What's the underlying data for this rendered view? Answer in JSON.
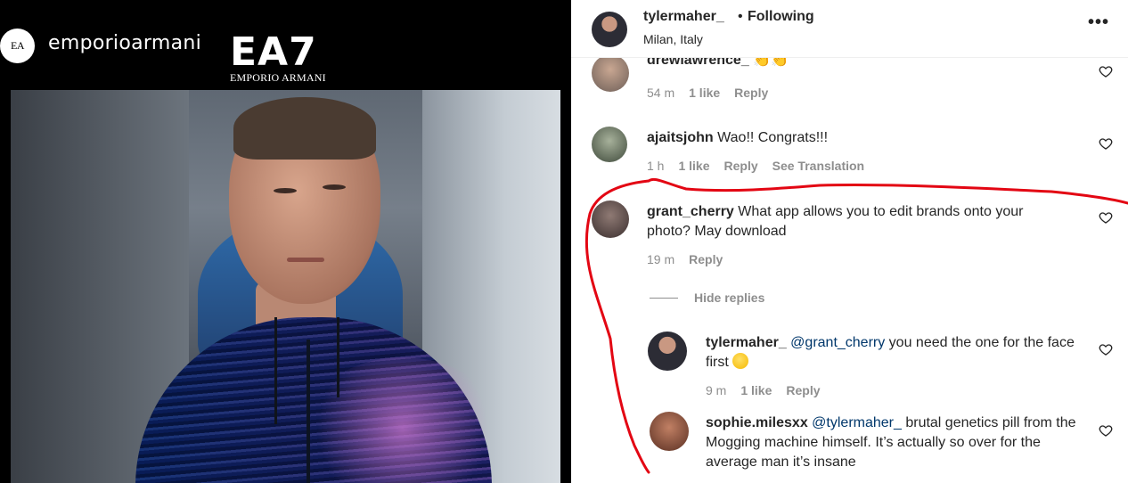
{
  "post": {
    "brand_logo_text": "EA",
    "brand_name": "emporioarmani",
    "ea7_big": "EA7",
    "ea7_small": "EMPORIO ARMANI"
  },
  "header": {
    "username": "tylermaher_",
    "dot": "•",
    "follow_label": "Following",
    "location": "Milan, Italy",
    "more_icon": "more-options-icon"
  },
  "comments": [
    {
      "username": "drewlawrence_",
      "text": " 👏👏",
      "time": "54 m",
      "likes": "1 like",
      "reply": "Reply"
    },
    {
      "username": "ajaitsjohn",
      "text": " Wao!! Congrats!!!",
      "time": "1 h",
      "likes": "1 like",
      "reply": "Reply",
      "translate": "See Translation"
    },
    {
      "username": "grant_cherry",
      "text": " What app allows you to edit brands onto your photo? May download",
      "time": "19 m",
      "reply": "Reply"
    }
  ],
  "hide_replies_label": "Hide replies",
  "replies": [
    {
      "username": "tylermaher_",
      "mention": "@grant_cherry",
      "text": " you need the one for the face first ",
      "time": "9 m",
      "likes": "1 like",
      "reply": "Reply"
    },
    {
      "username": "sophie.milesxx",
      "mention": "@tylermaher_",
      "text": " brutal genetics pill from the Mogging machine himself. It’s actually so over for the average man it’s insane"
    }
  ],
  "colors": {
    "annotation": "#e30613",
    "meta_gray": "#8e8e8e",
    "mention": "#00376b"
  }
}
